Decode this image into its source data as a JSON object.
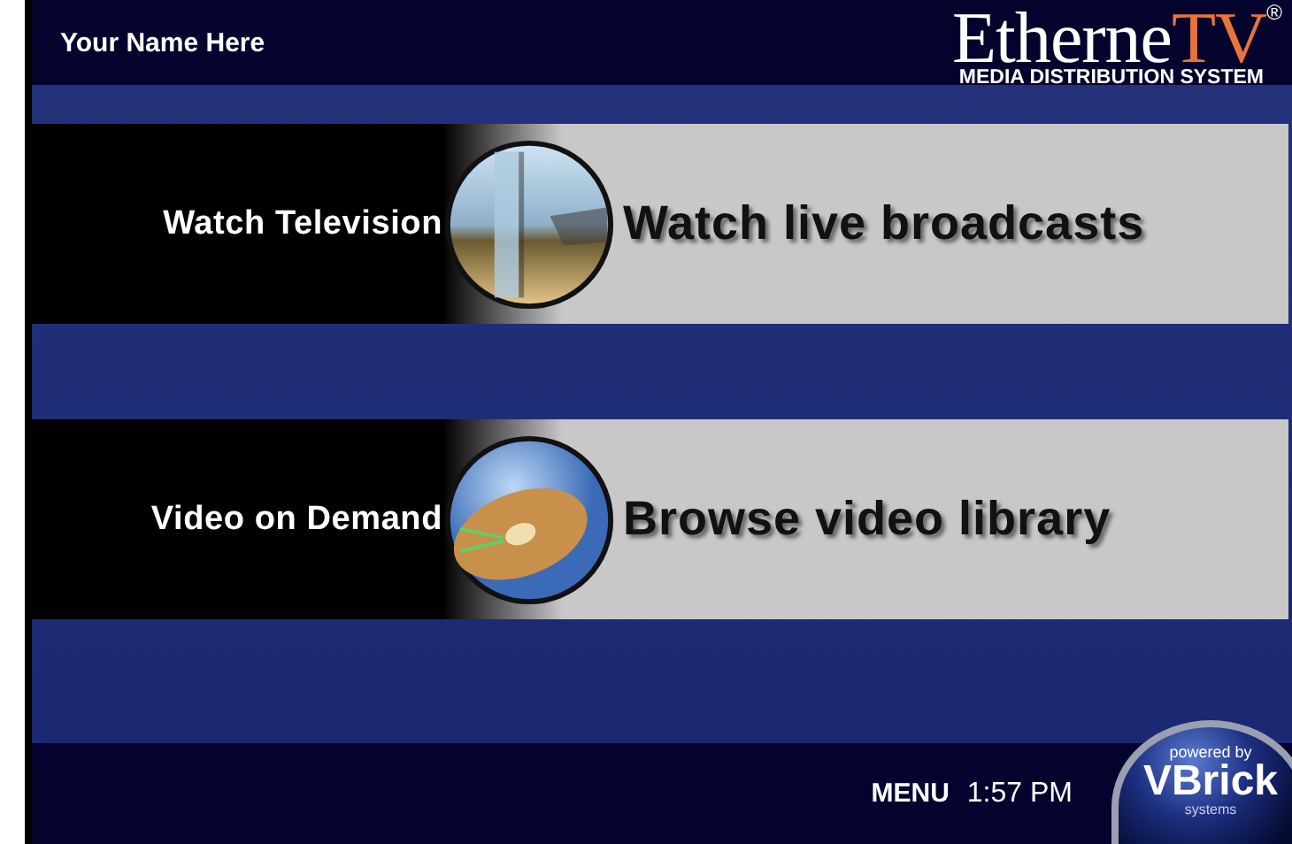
{
  "header": {
    "user_name": "Your Name Here",
    "logo": {
      "main": "Etherne",
      "accent": "TV",
      "mark": "®",
      "tagline": "MEDIA DISTRIBUTION SYSTEM"
    }
  },
  "menu_items": [
    {
      "label": "Watch Television",
      "description": "Watch live broadcasts",
      "kind": "television"
    },
    {
      "label": "Video on Demand",
      "description": "Browse video library",
      "kind": "disc"
    }
  ],
  "footer": {
    "menu": "MENU",
    "time": "1:57 PM",
    "badge": {
      "top": "powered by",
      "brand": "VBrick",
      "bottom": "systems"
    }
  }
}
